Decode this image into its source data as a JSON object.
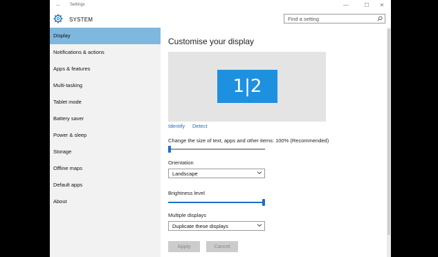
{
  "window": {
    "title": "Settings",
    "controls": {
      "minimize": "—",
      "maximize": "☐",
      "close": "✕"
    }
  },
  "header": {
    "section": "SYSTEM",
    "search_placeholder": "Find a setting"
  },
  "sidebar": {
    "items": [
      {
        "label": "Display",
        "active": true
      },
      {
        "label": "Notifications & actions"
      },
      {
        "label": "Apps & features"
      },
      {
        "label": "Multi-tasking"
      },
      {
        "label": "Tablet mode"
      },
      {
        "label": "Battery saver"
      },
      {
        "label": "Power & sleep"
      },
      {
        "label": "Storage"
      },
      {
        "label": "Offline maps"
      },
      {
        "label": "Default apps"
      },
      {
        "label": "About"
      }
    ]
  },
  "main": {
    "heading": "Customise your display",
    "monitor_label": "1|2",
    "identify": "Identify",
    "detect": "Detect",
    "scale_label": "Change the size of text, apps and other items: 100% (Recommended)",
    "scale_level": 0,
    "orientation_label": "Orientation",
    "orientation_value": "Landscape",
    "brightness_label": "Brightness level",
    "brightness_level": 1.0,
    "multiple_label": "Multiple displays",
    "multiple_value": "Duplicate these displays",
    "apply": "Apply",
    "cancel": "Cancel"
  },
  "colors": {
    "accent": "#1e90e0",
    "selected_nav": "#7fb8de",
    "link": "#1b6fc4"
  },
  "icons": {
    "back": "back-arrow-icon",
    "settings": "gear-icon",
    "search": "search-icon",
    "dropdown": "chevron-down-icon"
  }
}
